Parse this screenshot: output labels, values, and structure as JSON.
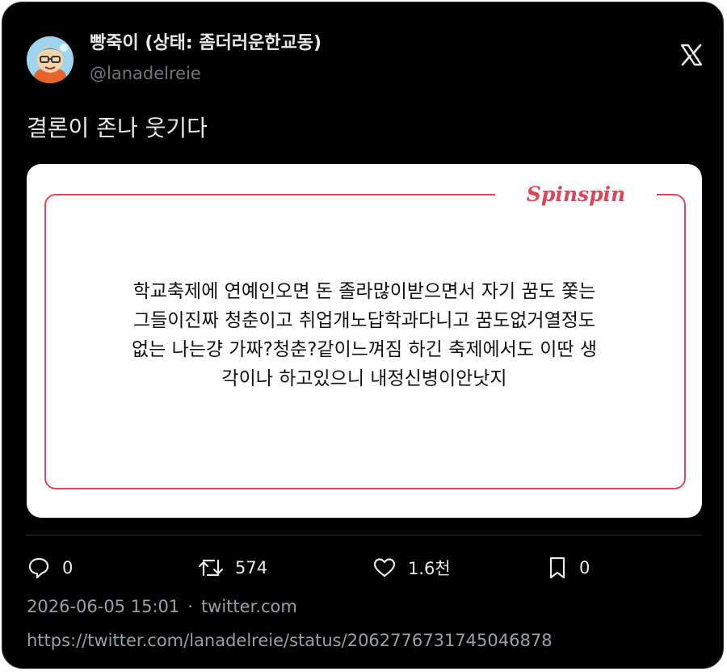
{
  "author": {
    "display_name": "빵죽이 (상태: 좀더러운한교동)",
    "handle": "@lanadelreie",
    "avatar_icon": "cartoon-avatar-icon"
  },
  "platform_icon": "x-logo-icon",
  "tweet": {
    "text": "결론이 존나 웃기다"
  },
  "media": {
    "brand": "Spinspin",
    "lines": [
      "학교축제에 연예인오면 돈 졸라많이받으면서 자기 꿈도 쫓는",
      "그들이진짜 청춘이고 취업개노답학과다니고 꿈도없거열정도",
      "없는 나는걍 가짜?청춘?같이느껴짐 하긴 축제에서도 이딴 생",
      "각이나 하고있으니 내정신병이안낫지"
    ],
    "accent_color": "#d9475a"
  },
  "actions": {
    "reply_count": "0",
    "retweet_count": "574",
    "like_count": "1.6천",
    "bookmark_count": "0"
  },
  "meta": {
    "timestamp": "2026-06-05 15:01",
    "separator": "·",
    "source": "twitter.com",
    "url": "https://twitter.com/lanadelreie/status/2062776731745046878"
  }
}
